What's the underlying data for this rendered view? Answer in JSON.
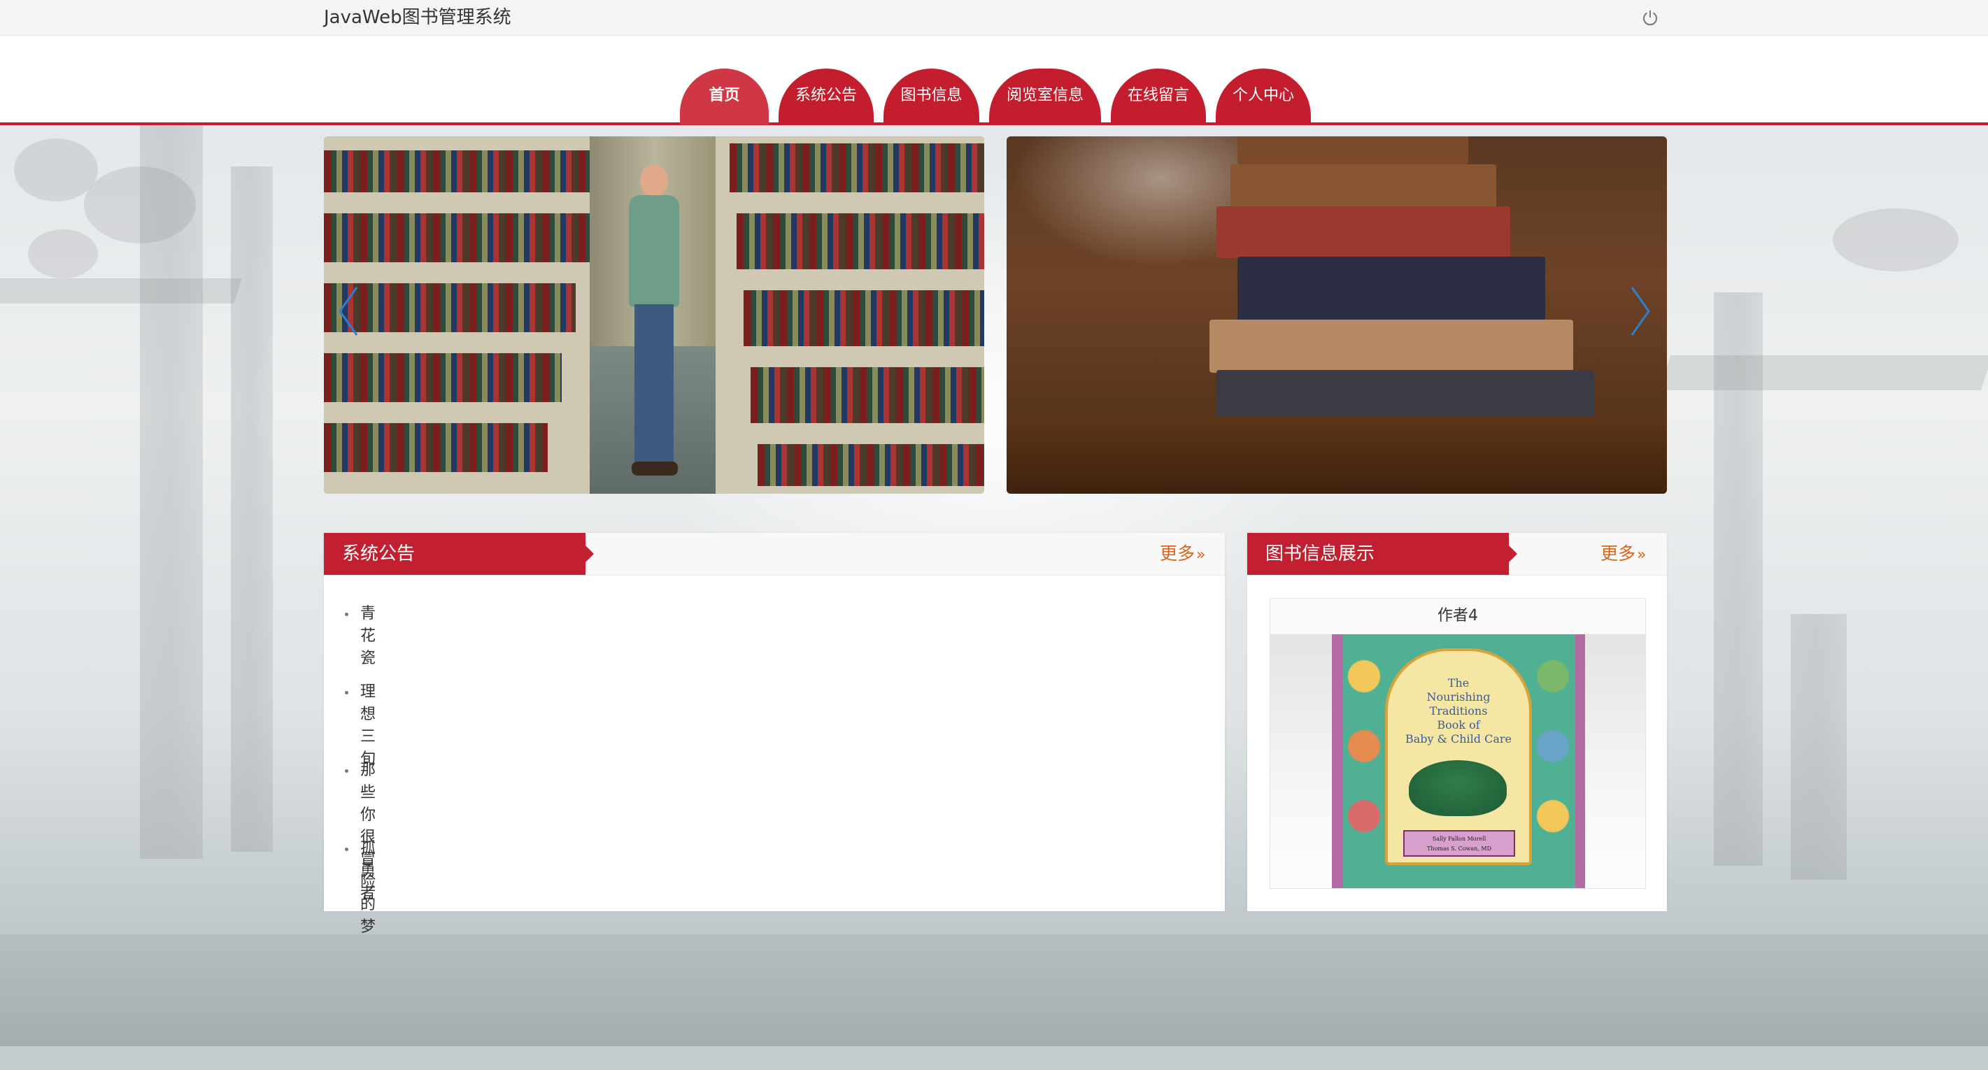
{
  "header": {
    "site_title": "JavaWeb图书管理系统",
    "logout_icon": "power-icon"
  },
  "nav": {
    "tabs": [
      {
        "label": "首页",
        "active": true
      },
      {
        "label": "系统公告",
        "active": false
      },
      {
        "label": "图书信息",
        "active": false
      },
      {
        "label": "阅览室信息",
        "active": false
      },
      {
        "label": "在线留言",
        "active": false
      },
      {
        "label": "个人中心",
        "active": false
      }
    ]
  },
  "carousel": {
    "prev_icon": "chevron-left-icon",
    "next_icon": "chevron-right-icon",
    "slides": [
      {
        "subject": "man reading in library stacks"
      },
      {
        "subject": "stack of old books on wooden table"
      }
    ]
  },
  "notice_panel": {
    "title": "系统公告",
    "more_label": "更多",
    "items": [
      {
        "label": "青花瓷"
      },
      {
        "label": "理想三旬"
      },
      {
        "label": "那些你很冒险的梦"
      },
      {
        "label": "孤勇者"
      }
    ]
  },
  "books_panel": {
    "title": "图书信息展示",
    "more_label": "更多",
    "featured": {
      "author": "作者4",
      "cover_title": "The\nNourishing\nTraditions\nBook of\nBaby & Child Care",
      "cover_authors": "Sally Fallon Morell\nThomas S. Cowan, MD"
    }
  },
  "colors": {
    "brand_red": "#c21f30",
    "active_tab": "#cf3745",
    "more_link": "#d8641e",
    "carousel_arrow": "#2f7fd1"
  }
}
